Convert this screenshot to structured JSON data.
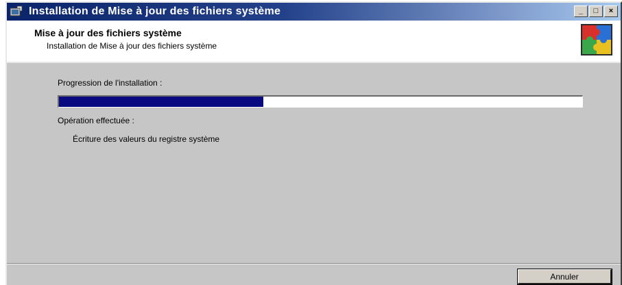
{
  "window": {
    "title": "Installation de Mise à jour des fichiers système",
    "controls": {
      "minimize": "_",
      "maximize": "□",
      "close": "×"
    }
  },
  "header": {
    "title": "Mise à jour des fichiers système",
    "subtitle": "Installation de Mise à jour des fichiers système",
    "icon": "puzzle-icon"
  },
  "progress": {
    "label": "Progression de l'installation :",
    "value": 0.39
  },
  "operation": {
    "label": "Opération effectuée :",
    "status": "Écriture des valeurs du registre système"
  },
  "buttons": {
    "cancel_label": "Annuler"
  },
  "colors": {
    "titlebar_start": "#0a246a",
    "titlebar_end": "#a6caf0",
    "progress_fill": "#0a0a80",
    "dialog_background": "#c6c6c6"
  }
}
